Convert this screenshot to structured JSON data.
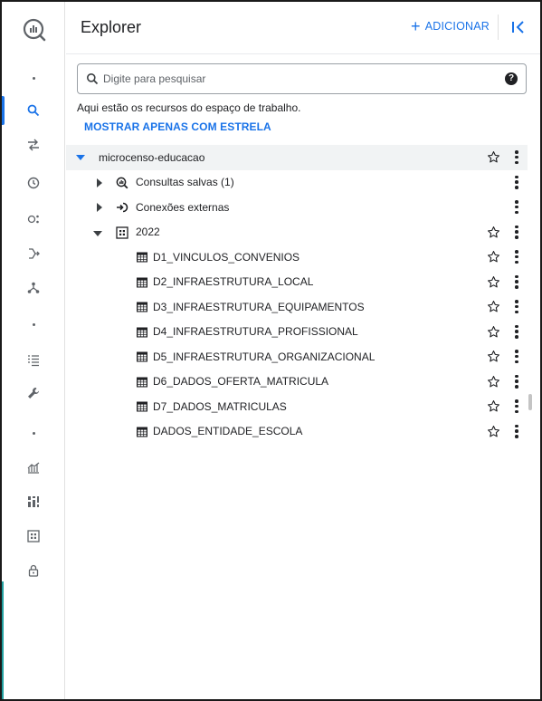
{
  "header": {
    "title": "Explorer",
    "add_label": "ADICIONAR",
    "collapse_icon": "collapse-panel-icon"
  },
  "search": {
    "placeholder": "Digite para pesquisar",
    "value": ""
  },
  "info_text": "Aqui estão os recursos do espaço de trabalho.",
  "starred_link": "MOSTRAR APENAS COM ESTRELA",
  "rail": {
    "active": "search",
    "items": [
      "dot",
      "search",
      "transfers",
      "history",
      "analytics",
      "pipeline",
      "dag",
      "dot",
      "list",
      "wrench",
      "dot",
      "chart",
      "dashboard",
      "table",
      "lock"
    ]
  },
  "tree": {
    "project": "microcenso-educacao",
    "saved_queries": "Consultas salvas (1)",
    "external": "Conexões externas",
    "dataset": "2022",
    "tables": [
      "D1_VINCULOS_CONVENIOS",
      "D2_INFRAESTRUTURA_LOCAL",
      "D3_INFRAESTRUTURA_EQUIPAMENTOS",
      "D4_INFRAESTRUTURA_PROFISSIONAL",
      "D5_INFRAESTRUTURA_ORGANIZACIONAL",
      "D6_DADOS_OFERTA_MATRICULA",
      "D7_DADOS_MATRICULAS",
      "DADOS_ENTIDADE_ESCOLA"
    ]
  },
  "colors": {
    "accent": "#1a73e8",
    "text": "#202124",
    "muted": "#5f6368"
  }
}
